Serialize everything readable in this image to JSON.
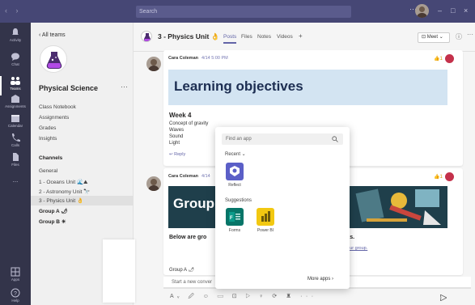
{
  "titlebar": {
    "nav": "‹ ›",
    "search_placeholder": "Search",
    "more": "···",
    "window_controls": [
      "–",
      "□",
      "×"
    ]
  },
  "rail": [
    {
      "label": "Activity",
      "icon": "bell-icon"
    },
    {
      "label": "Chat",
      "icon": "chat-icon"
    },
    {
      "label": "Teams",
      "icon": "teams-icon",
      "active": true
    },
    {
      "label": "Assignments",
      "icon": "assignments-icon"
    },
    {
      "label": "Calendar",
      "icon": "calendar-icon"
    },
    {
      "label": "Calls",
      "icon": "phone-icon"
    },
    {
      "label": "Files",
      "icon": "file-icon"
    },
    {
      "label": "...",
      "icon": "more-icon"
    },
    {
      "label": "Apps",
      "icon": "apps-icon"
    },
    {
      "label": "Help",
      "icon": "help-icon"
    }
  ],
  "left": {
    "back": "‹   All teams",
    "team_name": "Physical Science",
    "team_more": "···",
    "items": [
      "Class Notebook",
      "Assignments",
      "Grades",
      "Insights"
    ],
    "channels_heading": "Channels",
    "channels": [
      "General",
      "1 - Oceans Unit 🌊⛰",
      "2 - Astronomy Unit 🔭",
      "3 - Physics Unit 👌"
    ],
    "groups": [
      "Group A 🌶",
      "Group B ☀"
    ]
  },
  "header": {
    "title": "3 - Physics Unit 👌",
    "tabs": [
      "Posts",
      "Files",
      "Notes",
      "Videos"
    ],
    "add_tab": "+",
    "meet": "⊡ Meet  ⌄",
    "info": "ⓘ",
    "more": "···"
  },
  "post1": {
    "author": "Cara Coleman",
    "timestamp": "4/14 5:00 PM",
    "likes": "👍1",
    "banner_title": "Learning objectives",
    "week": "Week 4",
    "lines": [
      "Concept of gravity",
      "Waves",
      "Sound",
      "Light"
    ],
    "reply": "↩ Reply"
  },
  "post2": {
    "author": "Cara Coleman",
    "timestamp": "4/14",
    "likes": "👍1",
    "banner_title": "Group",
    "below": "Below are gro",
    "cts": "cts.",
    "link": "ur your group.",
    "group_a": "Group A 🌶"
  },
  "compose": {
    "placeholder": "Start a new conver",
    "toolbar": "Aᵥ 🖉 ☺ ▭ ⊡ ▷ ♀ ⟳ ♜ ···"
  },
  "popup": {
    "search_placeholder": "Find an app",
    "recent_label": "Recent  ⌄",
    "recent_app": "Reflect",
    "suggestions_label": "Suggestions",
    "suggestions": [
      "Forms",
      "Power BI"
    ],
    "more_apps": "More apps  ›"
  },
  "colors": {
    "titlebar": "#464775",
    "rail": "#33344a",
    "accent": "#6264a7",
    "banner_blue": "#d3e4f2",
    "banner_dark": "#1f3f4b"
  }
}
